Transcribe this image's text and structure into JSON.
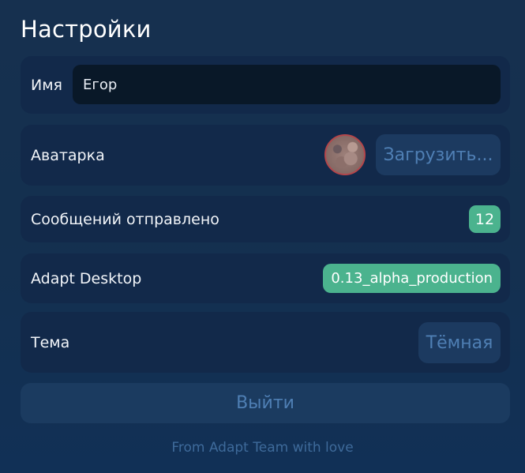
{
  "header": {
    "title": "Настройки"
  },
  "settings": {
    "name": {
      "label": "Имя",
      "value": "Егор"
    },
    "avatar": {
      "label": "Аватарка",
      "upload_label": "Загрузить..."
    },
    "messages": {
      "label": "Сообщений отправлено",
      "count": "12"
    },
    "app": {
      "label": "Adapt Desktop",
      "version": "0.13_alpha_production"
    },
    "theme": {
      "label": "Тема",
      "value": "Тёмная"
    }
  },
  "actions": {
    "logout_label": "Выйти"
  },
  "footer": {
    "text": "From Adapt Team with love"
  },
  "colors": {
    "background": "#14304f",
    "card": "#12294a",
    "input": "#091828",
    "accent_green": "#4bb38e",
    "button_bg": "#1c3a60",
    "button_text": "#4f7fb4",
    "avatar_border": "#b3464b"
  }
}
